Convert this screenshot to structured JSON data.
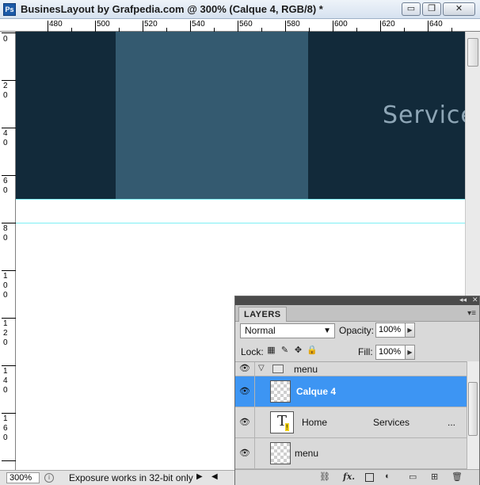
{
  "window": {
    "app_icon_label": "Ps",
    "title": "BusinesLayout by Grafpedia.com @ 300% (Calque 4, RGB/8) *",
    "minimize_glyph": "▭",
    "restore_glyph": "❐",
    "close_glyph": "✕"
  },
  "ruler_top": [
    "480",
    "500",
    "520",
    "540",
    "560",
    "580",
    "600",
    "620",
    "640"
  ],
  "ruler_left": [
    {
      "a": "0",
      "b": ""
    },
    {
      "a": "2",
      "b": "0"
    },
    {
      "a": "4",
      "b": "0"
    },
    {
      "a": "6",
      "b": "0"
    },
    {
      "a": "8",
      "b": "0"
    },
    {
      "a": "1",
      "b": "0",
      "c": "0"
    },
    {
      "a": "1",
      "b": "2",
      "c": "0"
    },
    {
      "a": "1",
      "b": "4",
      "c": "0"
    },
    {
      "a": "1",
      "b": "6",
      "c": "0"
    }
  ],
  "canvas": {
    "nav_text": "Service",
    "colors": {
      "nav_background": "#122a3a",
      "active_block": "#345a70",
      "guide": "#7ef0f5"
    }
  },
  "statusbar": {
    "zoom": "300%",
    "message": "Exposure works in 32-bit only",
    "forward_arrow": "▶",
    "back_arrow": "◀"
  },
  "layers_panel": {
    "tab_label": "LAYERS",
    "collapse_glyph": "◂◂",
    "close_glyph": "✕",
    "menu_glyph": "▾≡",
    "blend_mode": "Normal",
    "opacity_label": "Opacity:",
    "opacity_value": "100%",
    "lock_label": "Lock:",
    "fill_label": "Fill:",
    "fill_value": "100%",
    "layers": [
      {
        "name": "menu",
        "type": "group",
        "expanded": true,
        "visible": true,
        "selected": false
      },
      {
        "name": "Calque 4",
        "type": "pixel",
        "visible": true,
        "selected": true
      },
      {
        "name": "Home",
        "type": "text",
        "text_col2": "Services",
        "text_col3": "...",
        "warning": true,
        "visible": true,
        "selected": false
      },
      {
        "name": "menu",
        "type": "pixel",
        "visible": true,
        "selected": false
      }
    ],
    "bottom_icons": [
      "link-icon",
      "fx-icon",
      "mask-icon",
      "adjustment-icon",
      "folder-icon",
      "new-layer-icon",
      "trash-icon"
    ],
    "colors": {
      "selected_row": "#3d95f3"
    }
  }
}
